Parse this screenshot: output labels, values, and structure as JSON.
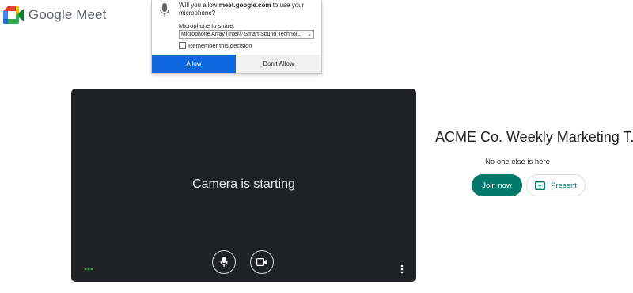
{
  "app": {
    "logo_text": "Google Meet"
  },
  "permission_popup": {
    "message_prefix": "Will you allow ",
    "site": "meet.google.com",
    "message_suffix": " to use your microphone?",
    "mic_label": "Microphone to share:",
    "mic_selected": "Microphone Array (Intel® Smart Sound Technol...",
    "remember_label": "Remember this decision",
    "allow_label": "Allow",
    "deny_label": "Don't Allow"
  },
  "preview": {
    "status_text": "Camera is starting"
  },
  "meeting": {
    "title": "ACME Co. Weekly Marketing T...",
    "participants_text": "No one else is here",
    "join_label": "Join now",
    "present_label": "Present"
  },
  "colors": {
    "allow_blue": "#0f68e0",
    "join_teal": "#00796b",
    "preview_bg": "#202124"
  }
}
